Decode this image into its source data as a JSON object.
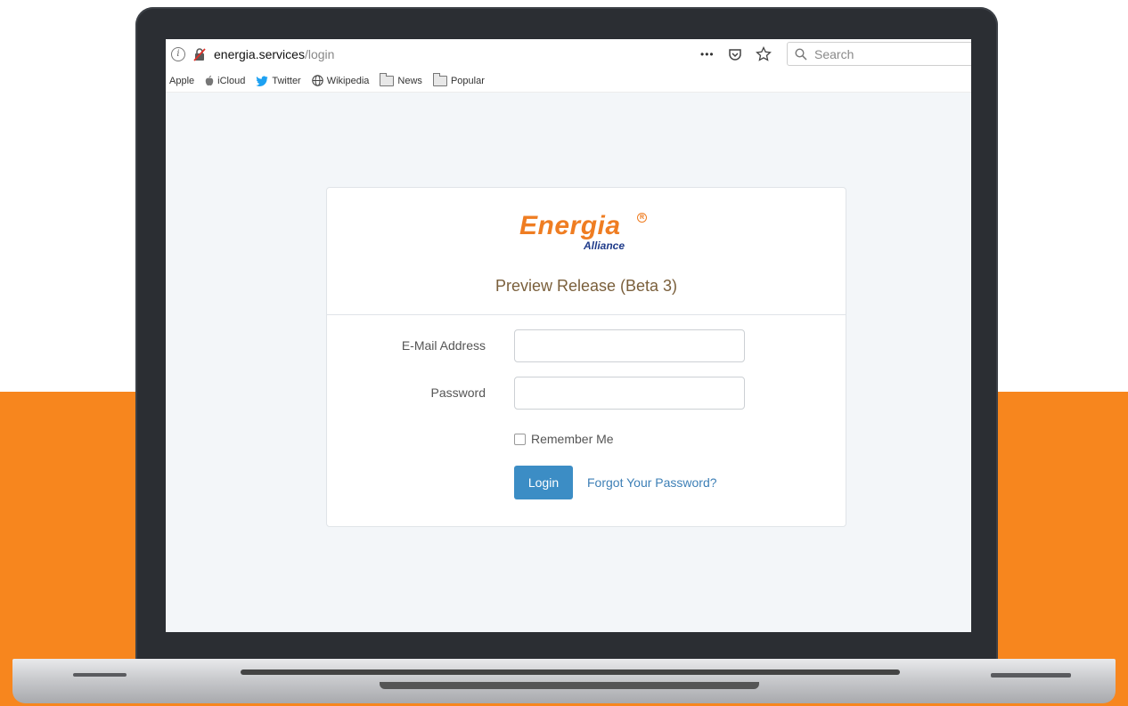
{
  "browser": {
    "url_domain": "energia.services",
    "url_path": "/login",
    "more_label": "•••",
    "search_placeholder": "Search",
    "bookmarks": [
      {
        "label": "Apple",
        "icon": "none"
      },
      {
        "label": "iCloud",
        "icon": "apple-icon"
      },
      {
        "label": "Twitter",
        "icon": "twitter-icon"
      },
      {
        "label": "Wikipedia",
        "icon": "globe-icon"
      },
      {
        "label": "News",
        "icon": "folder-icon"
      },
      {
        "label": "Popular",
        "icon": "folder-icon"
      }
    ]
  },
  "logo": {
    "main": "Energia",
    "registered": "R",
    "sub": "Alliance"
  },
  "login": {
    "release_title": "Preview Release (Beta 3)",
    "email_label": "E-Mail Address",
    "email_value": "",
    "password_label": "Password",
    "password_value": "",
    "remember_label": "Remember Me",
    "remember_checked": false,
    "login_button": "Login",
    "forgot_link": "Forgot Your Password?"
  },
  "colors": {
    "accent_orange": "#f7861e",
    "brand_orange": "#ef7d22",
    "brand_blue": "#1f3b8a",
    "button_blue": "#3c8dc5",
    "link_blue": "#3d7fb6"
  }
}
